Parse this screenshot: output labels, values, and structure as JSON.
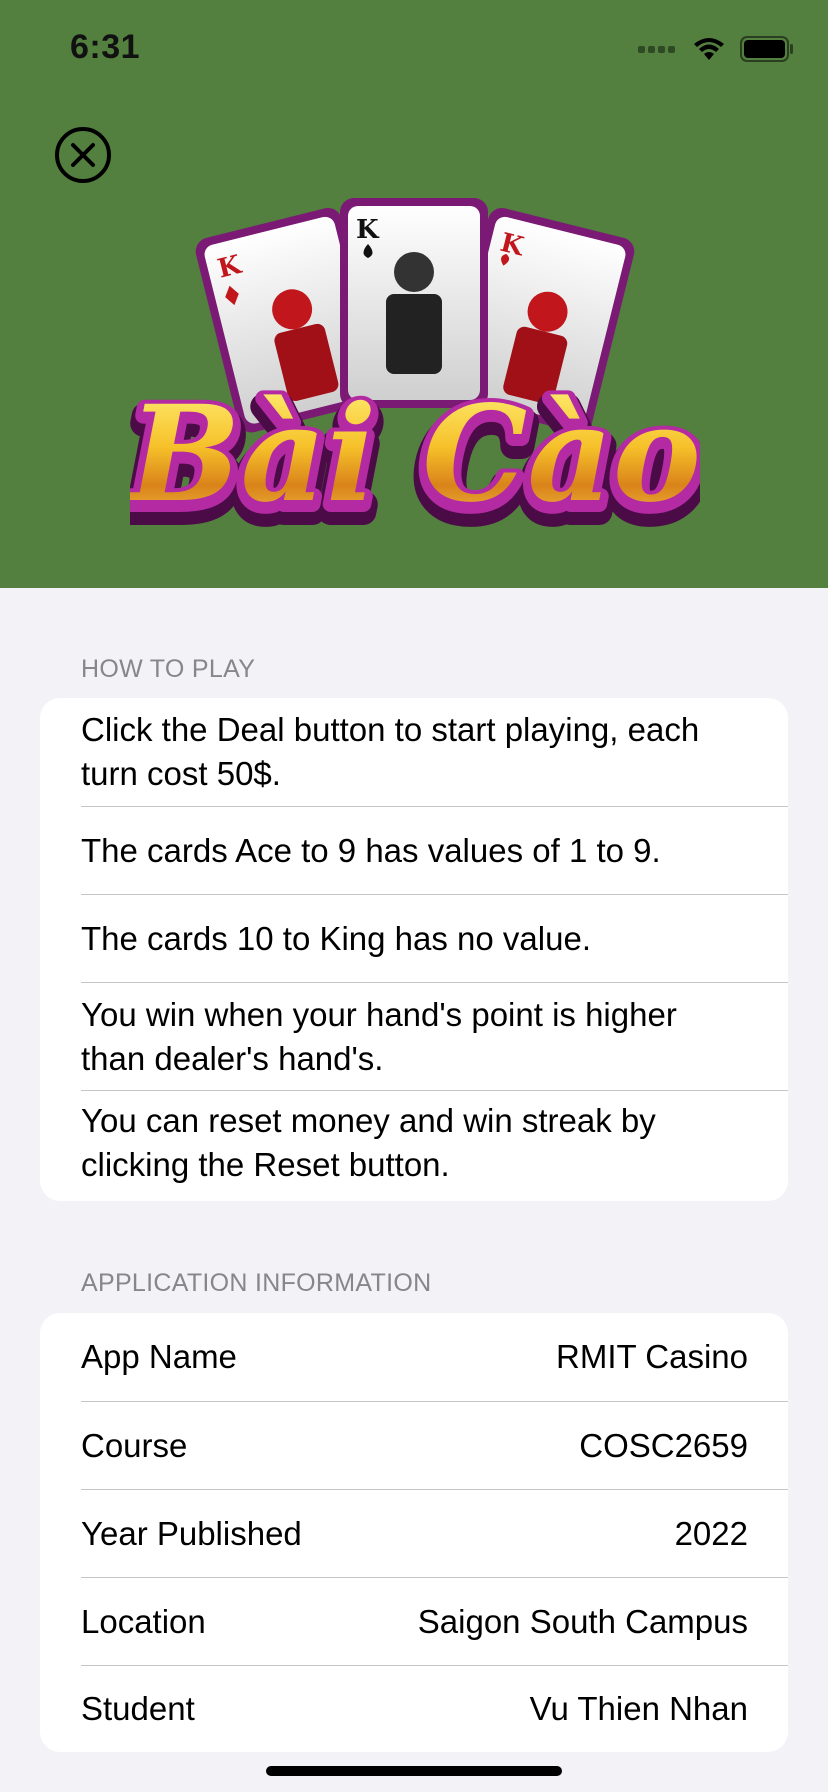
{
  "status_bar": {
    "time": "6:31"
  },
  "logo": {
    "title": "Bài Cào",
    "card_ranks": [
      "K",
      "K",
      "K"
    ]
  },
  "how_to_play": {
    "header": "HOW TO PLAY",
    "items": [
      "Click the Deal button to start playing, each turn cost 50$.",
      "The cards Ace to 9 has values of 1 to 9.",
      "The cards 10 to King has no value.",
      "You win when your hand's point is higher than dealer's hand's.",
      "You can reset money and win streak by clicking the Reset button."
    ]
  },
  "app_info": {
    "header": "APPLICATION INFORMATION",
    "rows": [
      {
        "label": "App Name",
        "value": "RMIT Casino"
      },
      {
        "label": "Course",
        "value": "COSC2659"
      },
      {
        "label": "Year Published",
        "value": "2022"
      },
      {
        "label": "Location",
        "value": "Saigon South Campus"
      },
      {
        "label": "Student",
        "value": "Vu Thien Nhan"
      }
    ]
  },
  "colors": {
    "hero_bg": "#537f3f",
    "page_bg": "#f2f2f7",
    "logo_gold": "#f2b820",
    "logo_purple": "#9c1f8c"
  }
}
